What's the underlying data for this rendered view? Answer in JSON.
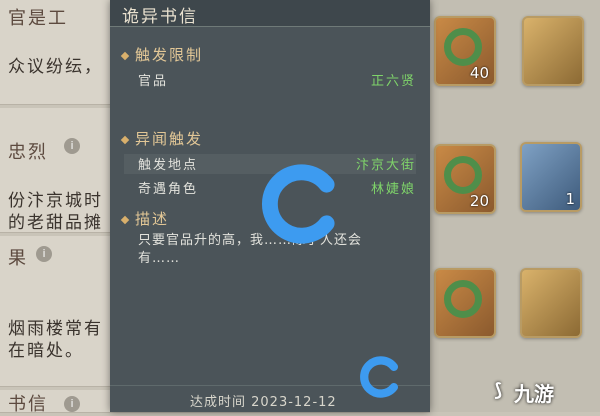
{
  "background_entries": [
    {
      "title_fragment": "官是工",
      "text_lines": [
        "众议纷纭，"
      ]
    },
    {
      "title_fragment": "忠烈",
      "text_lines": [
        "份汴京城时",
        "的老甜品摊"
      ]
    },
    {
      "title_fragment": "果",
      "text_lines": [
        "烟雨楼常有",
        "在暗处。"
      ]
    },
    {
      "title_fragment": "书信",
      "text_lines": []
    }
  ],
  "rewards": [
    {
      "count": "40"
    },
    {
      "count": ""
    },
    {
      "count": ""
    },
    {
      "count": "20"
    },
    {
      "count": "1"
    },
    {
      "count": ""
    },
    {
      "count": ""
    }
  ],
  "panel": {
    "title": "诡异书信",
    "sections": [
      {
        "title": "触发限制",
        "rows": [
          {
            "key": "官品",
            "value": "正六贤"
          }
        ]
      },
      {
        "title": "异闻触发",
        "rows": [
          {
            "key": "触发地点",
            "value": "汴京大街"
          },
          {
            "key": "奇遇角色",
            "value": "林婕娘"
          }
        ]
      },
      {
        "title": "描述",
        "text": "只要官品升的高，我……除了人还会有……"
      }
    ],
    "footer": "达成时间 2023-12-12"
  },
  "overlay": {
    "brand_text": "九游"
  },
  "colors": {
    "panel_bg": "#4b5459",
    "accent_gold": "#e2c796",
    "value_green": "#7fd46a",
    "logo_blue": "#3d9bf0"
  }
}
